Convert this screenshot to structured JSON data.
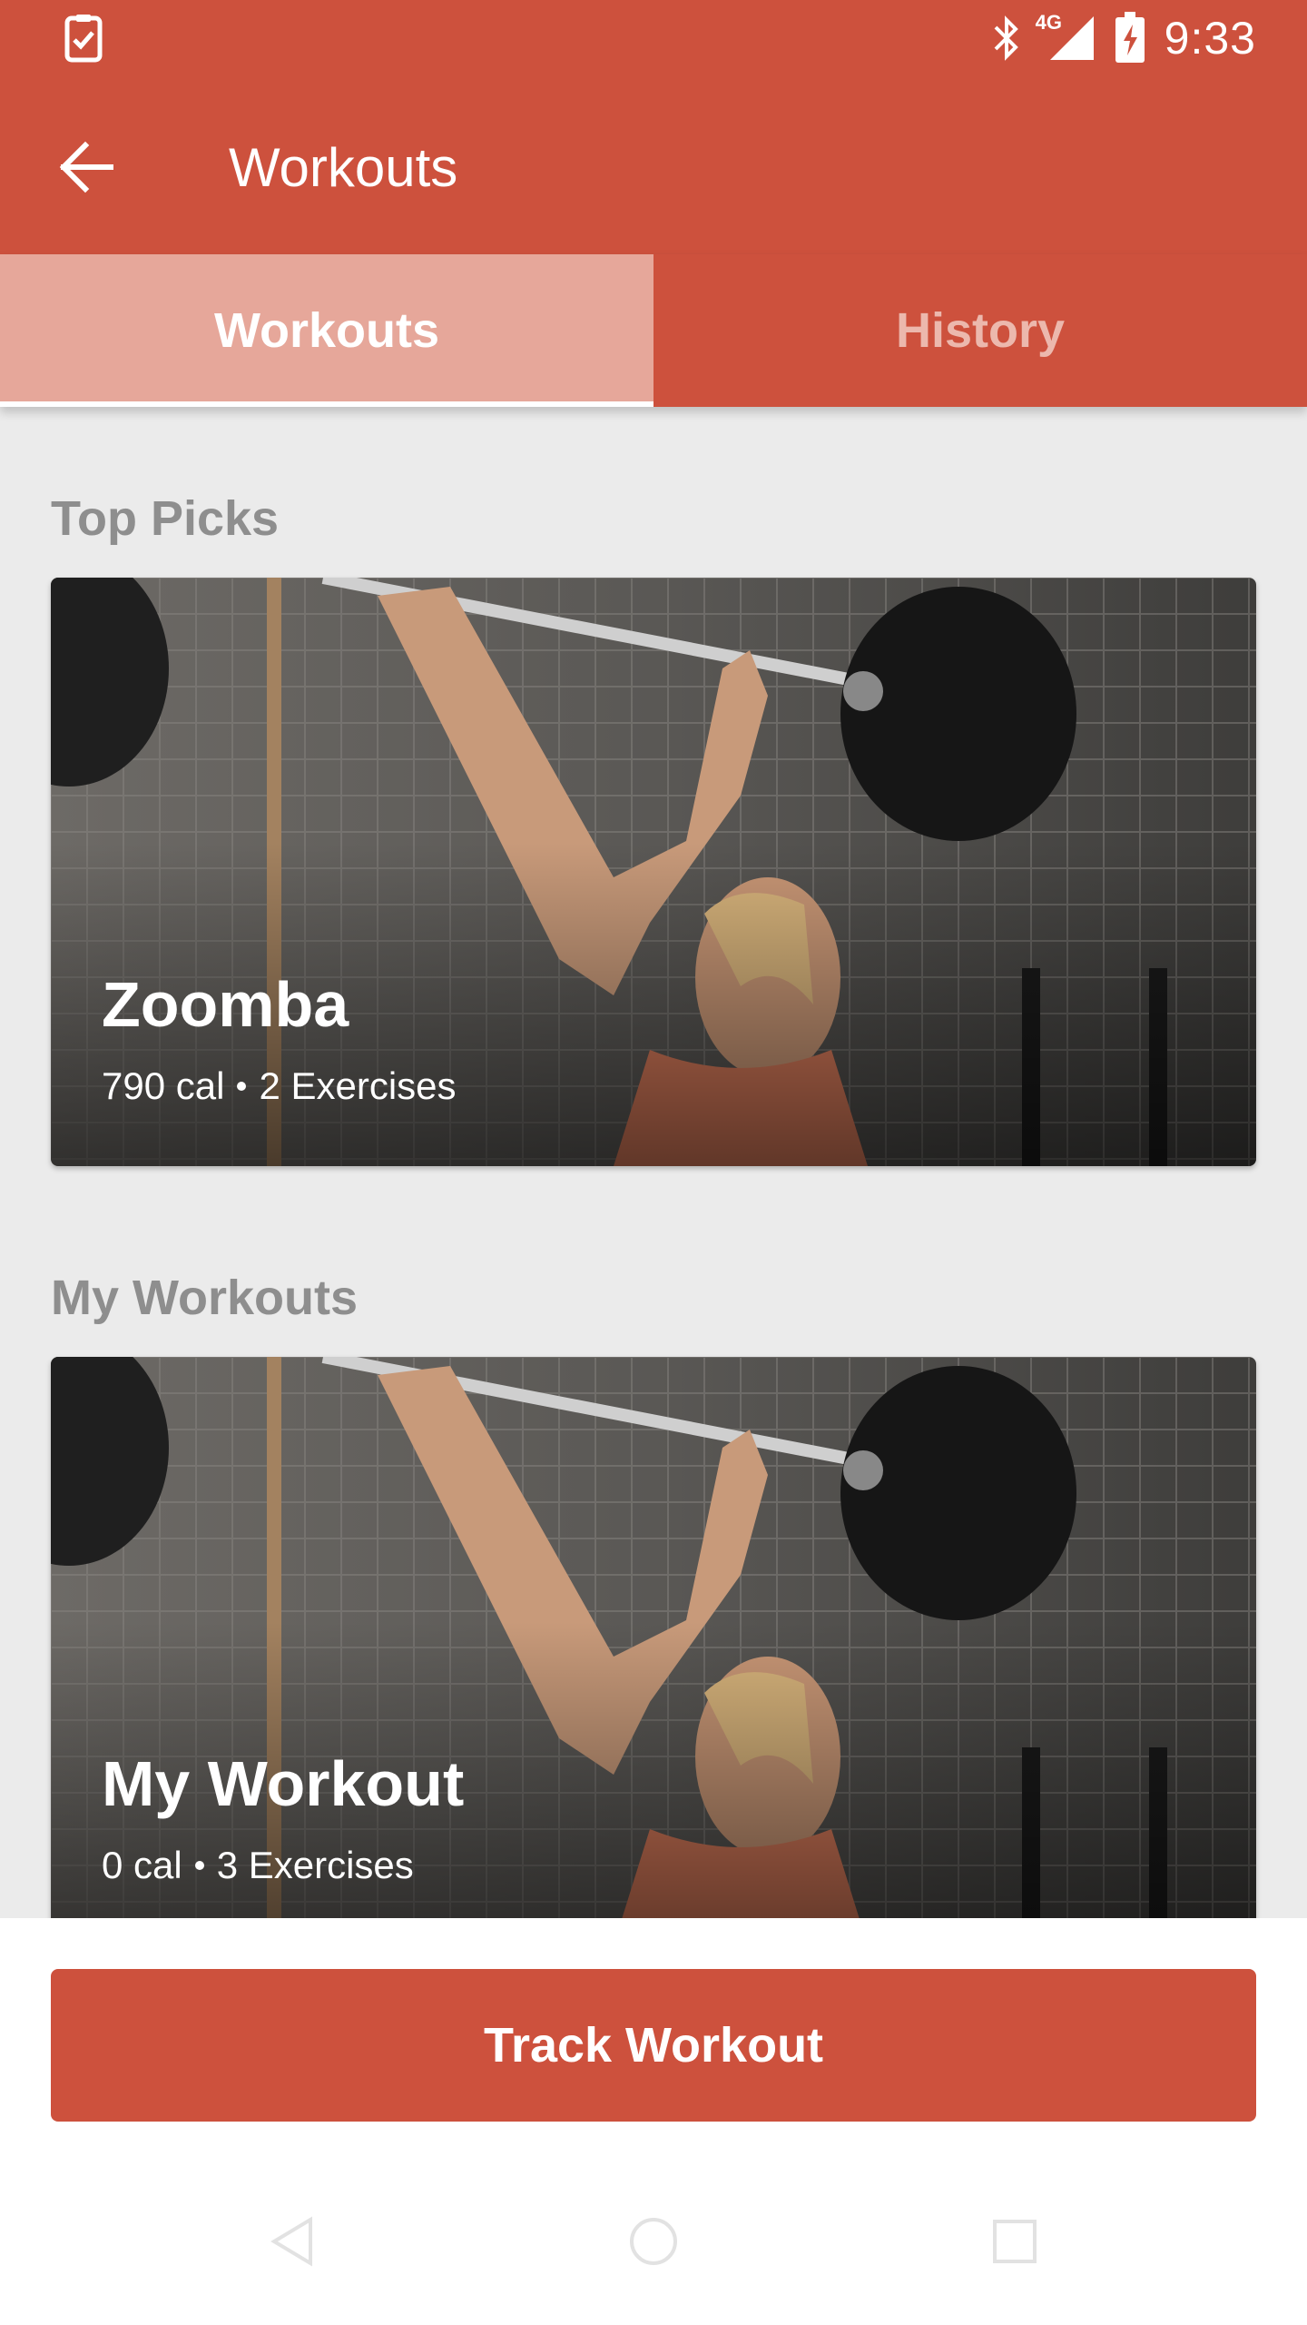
{
  "status_bar": {
    "time": "9:33",
    "network": "4G",
    "icons": [
      "task-icon",
      "bluetooth-icon",
      "signal-icon",
      "battery-charging-icon"
    ]
  },
  "app_bar": {
    "title": "Workouts",
    "back_icon": "arrow-back-icon"
  },
  "tabs": [
    {
      "label": "Workouts",
      "active": true
    },
    {
      "label": "History",
      "active": false
    }
  ],
  "sections": {
    "top_picks": {
      "heading": "Top Picks",
      "card": {
        "title": "Zoomba",
        "calories": "790 cal",
        "exercises": "2 Exercises"
      }
    },
    "my_workouts": {
      "heading": "My Workouts",
      "card": {
        "title": "My Workout",
        "calories": "0 cal",
        "exercises": "3 Exercises"
      }
    }
  },
  "primary_action": {
    "label": "Track Workout"
  },
  "system_nav": {
    "icons": [
      "nav-back-icon",
      "nav-home-icon",
      "nav-recents-icon"
    ]
  },
  "colors": {
    "primary": "#cd513d",
    "tab_active_bg": "#e6a79a",
    "background": "#ebebeb",
    "section_heading": "#8e8e8e"
  }
}
